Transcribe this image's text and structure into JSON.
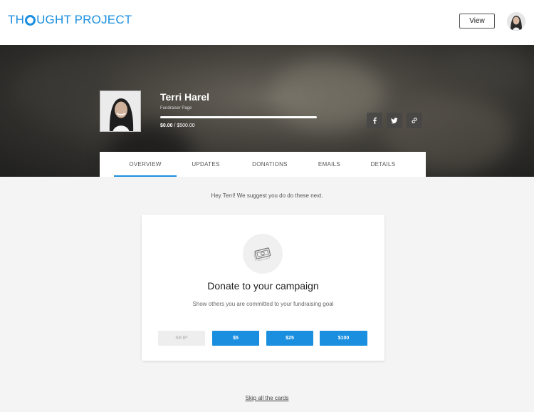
{
  "header": {
    "logo_prefix": "TH",
    "logo_suffix": "UGHT PROJECT",
    "view_label": "View"
  },
  "profile": {
    "name": "Terri Harel",
    "subtitle": "Fundraiser Page",
    "raised": "$0.00",
    "goal": " / $500.00",
    "progress_percent": 0
  },
  "social": [
    {
      "icon": "facebook-icon"
    },
    {
      "icon": "twitter-icon"
    },
    {
      "icon": "link-icon"
    }
  ],
  "tabs": [
    {
      "label": "OVERVIEW",
      "active": true
    },
    {
      "label": "UPDATES",
      "active": false
    },
    {
      "label": "DONATIONS",
      "active": false
    },
    {
      "label": "EMAILS",
      "active": false
    },
    {
      "label": "DETAILS",
      "active": false
    }
  ],
  "suggestion": "Hey Terri! We suggest you do do these next.",
  "card": {
    "icon": "cash-icon",
    "title": "Donate to your campaign",
    "description": "Show others you are committed to your fundraising goal",
    "skip_label": "SKIP",
    "amounts": [
      "$5",
      "$25",
      "$100"
    ]
  },
  "skip_all": "Skip all the cards",
  "colors": {
    "accent": "#1a8fe0"
  }
}
